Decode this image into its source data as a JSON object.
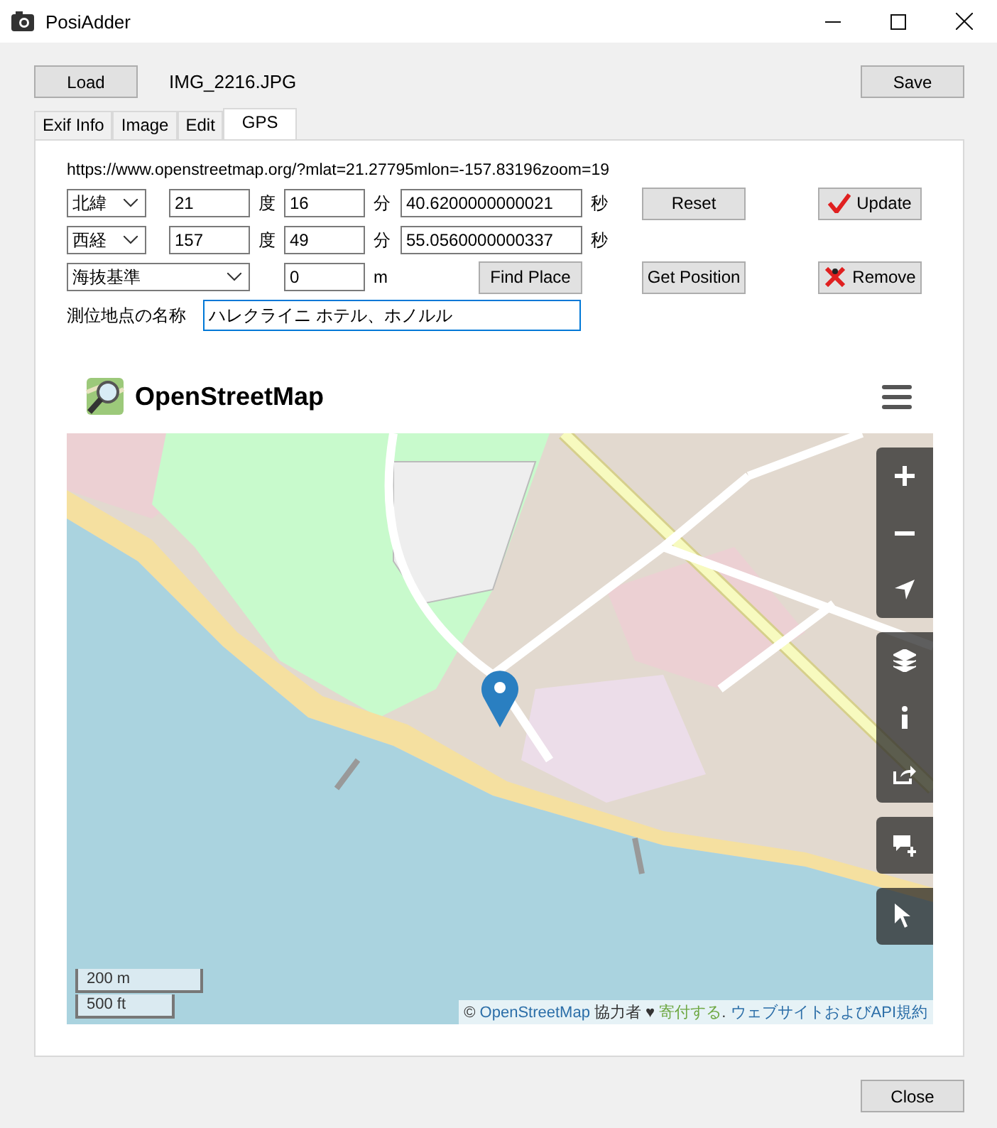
{
  "window": {
    "title": "PosiAdder"
  },
  "toolbar": {
    "load_button": "Load",
    "filename": "IMG_2216.JPG",
    "save_button": "Save"
  },
  "tabs": [
    {
      "label": "Exif Info",
      "selected": false
    },
    {
      "label": "Image",
      "selected": false
    },
    {
      "label": "Edit",
      "selected": false
    },
    {
      "label": "GPS",
      "selected": true
    }
  ],
  "gps": {
    "url": "https://www.openstreetmap.org/?mlat=21.27795mlon=-157.83196zoom=19",
    "coordinates": [
      {
        "hemisphere": "北緯",
        "degrees": "21",
        "degree_unit": "度",
        "minutes": "16",
        "minute_unit": "分",
        "seconds": "40.6200000000021",
        "second_unit": "秒"
      },
      {
        "hemisphere": "西経",
        "degrees": "157",
        "degree_unit": "度",
        "minutes": "49",
        "minute_unit": "分",
        "seconds": "55.0560000000337",
        "second_unit": "秒"
      }
    ],
    "altitude": {
      "reference": "海抜基準",
      "value": "0",
      "unit": "m"
    },
    "place": {
      "label": "測位地点の名称",
      "value": "ハレクライニ ホテル、ホノルル"
    },
    "buttons": {
      "reset": "Reset",
      "update": "Update",
      "find_place": "Find Place",
      "get_position": "Get Position",
      "remove": "Remove"
    }
  },
  "map": {
    "brand": "OpenStreetMap",
    "scale": [
      "200 m",
      "500 ft"
    ],
    "attribution": [
      {
        "kind": "text",
        "text": "© "
      },
      {
        "kind": "link",
        "text": "OpenStreetMap"
      },
      {
        "kind": "text",
        "text": " 協力者 ♥ "
      },
      {
        "kind": "donate",
        "text": "寄付する"
      },
      {
        "kind": "text",
        "text": ". "
      },
      {
        "kind": "link",
        "text": "ウェブサイトおよびAPI規約"
      }
    ]
  },
  "close_button": "Close"
}
